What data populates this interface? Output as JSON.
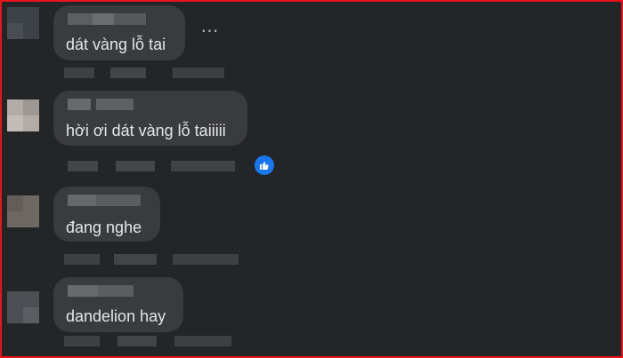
{
  "comments": [
    {
      "text": "dát vàng lỗ tai"
    },
    {
      "text": "hời ơi dát vàng lỗ taiiiii"
    },
    {
      "text": "đang nghe"
    },
    {
      "text": "dandelion hay"
    }
  ],
  "icons": {
    "more": "more-options-icon",
    "like": "like-reaction-icon"
  },
  "colors": {
    "background": "#242526",
    "bubble": "#3a3b3c",
    "text": "#e4e6eb",
    "like": "#1877f2",
    "border": "#e8141c"
  }
}
